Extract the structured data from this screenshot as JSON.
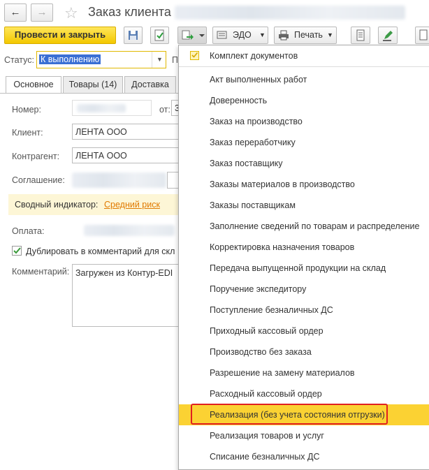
{
  "window": {
    "title": "Заказ клиента"
  },
  "toolbar": {
    "post_close_label": "Провести и закрыть",
    "edo_label": "ЭДО",
    "print_label": "Печать"
  },
  "status": {
    "label": "Статус:",
    "value": "К выполнению",
    "next_label": "П"
  },
  "tabs": [
    {
      "label": "Основное"
    },
    {
      "label": "Товары (14)"
    },
    {
      "label": "Доставка"
    }
  ],
  "form": {
    "number_label": "Номер:",
    "from_label": "от:",
    "from_value": "3",
    "client_label": "Клиент:",
    "client_value": "ЛЕНТА ООО",
    "contragent_label": "Контрагент:",
    "contragent_value": "ЛЕНТА ООО",
    "agreement_label": "Соглашение:",
    "indicator_label": "Сводный индикатор:",
    "indicator_value": "Средний риск",
    "payment_label": "Оплата:",
    "duplicate_label": "Дублировать в комментарий для скл",
    "comment_label": "Комментарий:",
    "comment_value": "Загружен из Контур-EDI"
  },
  "menu": {
    "header": "Комплект документов",
    "items": [
      "Акт выполненных работ",
      "Доверенность",
      "Заказ на производство",
      "Заказ переработчику",
      "Заказ поставщику",
      "Заказы материалов в производство",
      "Заказы поставщикам",
      "Заполнение сведений по товарам и распределение",
      "Корректировка назначения товаров",
      "Передача выпущенной продукции на склад",
      "Поручение экспедитору",
      "Поступление безналичных ДС",
      "Приходный кассовый ордер",
      "Производство без заказа",
      "Разрешение на замену материалов",
      "Расходный кассовый ордер",
      "Реализация (без учета состояния отгрузки)",
      "Реализация товаров и услуг",
      "Списание безналичных ДС"
    ],
    "selected": "Реализация (без учета состояния отгрузки)"
  },
  "colors": {
    "primary": "#f3c800",
    "selected": "#fbd233",
    "highlight": "#e02020",
    "link": "#e07a00"
  }
}
